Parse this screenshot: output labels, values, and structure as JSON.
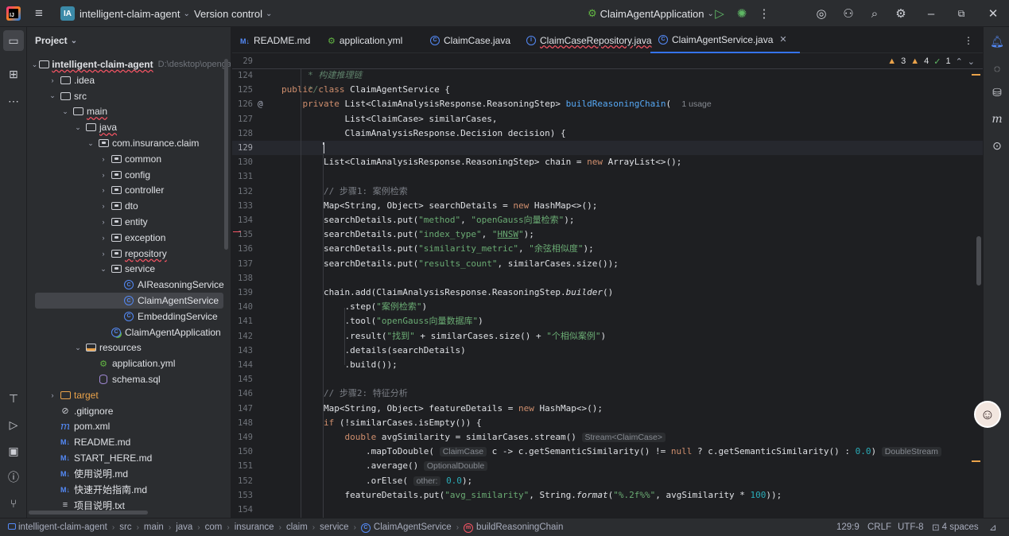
{
  "titlebar": {
    "project_badge": "IA",
    "project_name": "intelligent-claim-agent",
    "vcs": "Version control",
    "run_config": "ClaimAgentApplication"
  },
  "project_panel": {
    "title": "Project",
    "root_name": "intelligent-claim-agent",
    "root_path": "D:\\desktop\\openga",
    "items": [
      {
        "label": "intelligent-claim-agent",
        "indent": 0,
        "icon": "folder-icon",
        "expanded": true
      },
      {
        "label": ".idea",
        "indent": 1,
        "icon": "folder-icon",
        "expanded": false
      },
      {
        "label": "src",
        "indent": 1,
        "icon": "folder-icon",
        "expanded": true
      },
      {
        "label": "main",
        "indent": 2,
        "icon": "folder-icon",
        "expanded": true
      },
      {
        "label": "java",
        "indent": 3,
        "icon": "folder-icon",
        "expanded": true
      },
      {
        "label": "com.insurance.claim",
        "indent": 4,
        "icon": "package-icon",
        "expanded": true
      },
      {
        "label": "common",
        "indent": 5,
        "icon": "package-icon",
        "expanded": false
      },
      {
        "label": "config",
        "indent": 5,
        "icon": "package-icon",
        "expanded": false
      },
      {
        "label": "controller",
        "indent": 5,
        "icon": "package-icon",
        "expanded": false
      },
      {
        "label": "dto",
        "indent": 5,
        "icon": "package-icon",
        "expanded": false
      },
      {
        "label": "entity",
        "indent": 5,
        "icon": "package-icon",
        "expanded": false
      },
      {
        "label": "exception",
        "indent": 5,
        "icon": "package-icon",
        "expanded": false
      },
      {
        "label": "repository",
        "indent": 5,
        "icon": "package-icon",
        "expanded": false
      },
      {
        "label": "service",
        "indent": 5,
        "icon": "package-icon",
        "expanded": true
      },
      {
        "label": "AIReasoningService",
        "indent": 6,
        "icon": "class-icon"
      },
      {
        "label": "ClaimAgentService",
        "indent": 6,
        "icon": "class-icon",
        "selected": true
      },
      {
        "label": "EmbeddingService",
        "indent": 6,
        "icon": "class-icon"
      },
      {
        "label": "ClaimAgentApplication",
        "indent": 5,
        "icon": "spring-class-icon"
      },
      {
        "label": "resources",
        "indent": 3,
        "icon": "resources-folder-icon",
        "expanded": true
      },
      {
        "label": "application.yml",
        "indent": 4,
        "icon": "yml-icon"
      },
      {
        "label": "schema.sql",
        "indent": 4,
        "icon": "sql-icon"
      },
      {
        "label": "target",
        "indent": 1,
        "icon": "excluded-folder-icon",
        "expanded": false
      },
      {
        "label": ".gitignore",
        "indent": 1,
        "icon": "gitignore-icon"
      },
      {
        "label": "pom.xml",
        "indent": 1,
        "icon": "maven-icon"
      },
      {
        "label": "README.md",
        "indent": 1,
        "icon": "markdown-icon"
      },
      {
        "label": "START_HERE.md",
        "indent": 1,
        "icon": "markdown-icon"
      },
      {
        "label": "使用说明.md",
        "indent": 1,
        "icon": "markdown-icon"
      },
      {
        "label": "快速开始指南.md",
        "indent": 1,
        "icon": "markdown-icon"
      },
      {
        "label": "项目说明.txt",
        "indent": 1,
        "icon": "text-file-icon"
      }
    ]
  },
  "tabs": [
    {
      "label": "README.md",
      "icon": "markdown-icon"
    },
    {
      "label": "application.yml",
      "icon": "yml-icon"
    },
    {
      "label": "ClaimCase.java",
      "icon": "class-icon"
    },
    {
      "label": "ClaimCaseRepository.java",
      "icon": "interface-icon",
      "error": true
    },
    {
      "label": "ClaimAgentService.java",
      "icon": "class-icon",
      "active": true
    }
  ],
  "editor": {
    "sticky_line_number": "29",
    "sticky_text": "public class ClaimAgentService {",
    "inspections": {
      "warnings_a": "3",
      "warnings_b": "4",
      "ok": "1"
    },
    "usage_hint": "1 usage",
    "current_line": "129",
    "lines": [
      {
        "n": "124",
        "html": "<span class=\"cmt-i\">     * 构建推理链</span>"
      },
      {
        "n": "125",
        "html": "<span class=\"cmt-i\">     */</span>"
      },
      {
        "n": "126",
        "html": "    <span class=\"kw\">private</span> List&lt;ClaimAnalysisResponse.ReasoningStep&gt; <span class=\"fn\">buildReasoningChain</span>(  <span class=\"usage\">1 usage</span>"
      },
      {
        "n": "127",
        "html": "            List&lt;ClaimCase&gt; similarCases,"
      },
      {
        "n": "128",
        "html": "            ClaimAnalysisResponse.Decision decision) {"
      },
      {
        "n": "129",
        "html": "        "
      },
      {
        "n": "130",
        "html": "        List&lt;ClaimAnalysisResponse.ReasoningStep&gt; chain = <span class=\"kw\">new</span> ArrayList&lt;&gt;();"
      },
      {
        "n": "131",
        "html": ""
      },
      {
        "n": "132",
        "html": "        <span class=\"com\">// 步骤1: 案例检索</span>"
      },
      {
        "n": "133",
        "html": "        Map&lt;String, Object&gt; searchDetails = <span class=\"kw\">new</span> HashMap&lt;&gt;();"
      },
      {
        "n": "134",
        "html": "        searchDetails.put(<span class=\"str\">\"method\"</span>, <span class=\"str\">\"openGauss向量检索\"</span>);"
      },
      {
        "n": "135",
        "html": "        searchDetails.put(<span class=\"str\">\"index_type\"</span>, <span class=\"str\">\"<u>HNSW</u>\"</span>);"
      },
      {
        "n": "136",
        "html": "        searchDetails.put(<span class=\"str\">\"similarity_metric\"</span>, <span class=\"str\">\"余弦相似度\"</span>);"
      },
      {
        "n": "137",
        "html": "        searchDetails.put(<span class=\"str\">\"results_count\"</span>, similarCases.size());"
      },
      {
        "n": "138",
        "html": ""
      },
      {
        "n": "139",
        "html": "        chain.add(ClaimAnalysisResponse.ReasoningStep.<span class=\"ital\">builder</span>()"
      },
      {
        "n": "140",
        "html": "            .step(<span class=\"str\">\"案例检索\"</span>)"
      },
      {
        "n": "141",
        "html": "            .tool(<span class=\"str\">\"openGauss向量数据库\"</span>)"
      },
      {
        "n": "142",
        "html": "            .result(<span class=\"str\">\"找到\"</span> + similarCases.size() + <span class=\"str\">\"个相似案例\"</span>)"
      },
      {
        "n": "143",
        "html": "            .details(searchDetails)"
      },
      {
        "n": "144",
        "html": "            .build());"
      },
      {
        "n": "145",
        "html": ""
      },
      {
        "n": "146",
        "html": "        <span class=\"com\">// 步骤2: 特征分析</span>"
      },
      {
        "n": "147",
        "html": "        Map&lt;String, Object&gt; featureDetails = <span class=\"kw\">new</span> HashMap&lt;&gt;();"
      },
      {
        "n": "148",
        "html": "        <span class=\"kw\">if</span> (!similarCases.isEmpty()) {"
      },
      {
        "n": "149",
        "html": "            <span class=\"kw\">double</span> avgSimilarity = similarCases.stream() <span class=\"hint\">Stream&lt;ClaimCase&gt;</span>"
      },
      {
        "n": "150",
        "html": "                .mapToDouble( <span class=\"hint\">ClaimCase</span> c -&gt; c.getSemanticSimilarity() != <span class=\"kw\">null</span> ? c.getSemanticSimilarity() : <span class=\"num\">0.0</span>) <span class=\"hint\">DoubleStream</span>"
      },
      {
        "n": "151",
        "html": "                .average() <span class=\"hint\">OptionalDouble</span>"
      },
      {
        "n": "152",
        "html": "                .orElse( <span class=\"hint\">other:</span> <span class=\"num\">0.0</span>);"
      },
      {
        "n": "153",
        "html": "            featureDetails.put(<span class=\"str\">\"avg_similarity\"</span>, String.<span class=\"ital\">format</span>(<span class=\"str\">\"%.2f%%\"</span>, avgSimilarity * <span class=\"num\">100</span>));"
      },
      {
        "n": "154",
        "html": ""
      }
    ]
  },
  "statusbar": {
    "breadcrumbs": [
      "intelligent-claim-agent",
      "src",
      "main",
      "java",
      "com",
      "insurance",
      "claim",
      "service",
      "ClaimAgentService",
      "buildReasoningChain"
    ],
    "position": "129:9",
    "line_sep": "CRLF",
    "encoding": "UTF-8",
    "indent": "4 spaces"
  },
  "colors": {
    "accent": "#3574f0",
    "bg": "#1e1f22",
    "panel": "#2b2d30"
  }
}
